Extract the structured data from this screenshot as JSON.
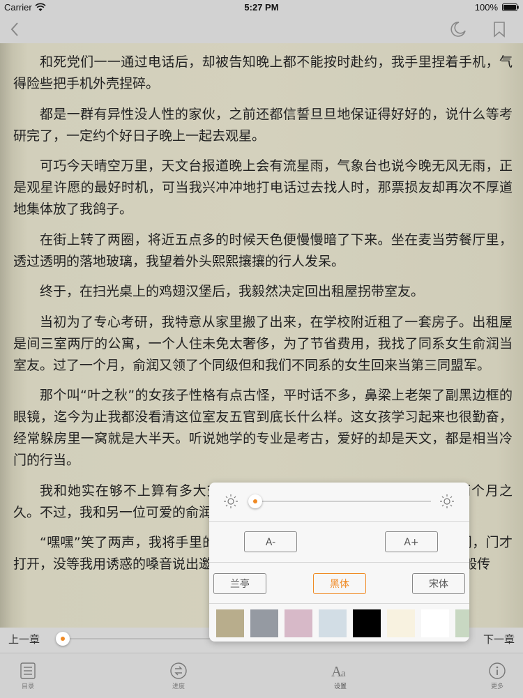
{
  "status_bar": {
    "carrier": "Carrier",
    "time": "5:27 PM",
    "battery": "100%"
  },
  "nav": {
    "back_icon": "chevron-left-icon",
    "night_icon": "moon-icon",
    "bookmark_icon": "bookmark-icon"
  },
  "content": {
    "paragraphs": [
      "和死党们一一通过电话后，却被告知晚上都不能按时赴约，我手里捏着手机，气得险些把手机外壳捏碎。",
      "都是一群有异性没人性的家伙，之前还都信誓旦旦地保证得好好的，说什么等考研完了，一定约个好日子晚上一起去观星。",
      "可巧今天晴空万里，天文台报道晚上会有流星雨，气象台也说今晚无风无雨，正是观星许愿的最好时机，可当我兴冲冲地打电话过去找人时，那票损友却再次不厚道地集体放了我鸽子。",
      "在街上转了两圈，将近五点多的时候天色便慢慢暗了下来。坐在麦当劳餐厅里，透过透明的落地玻璃，我望着外头熙熙攘攘的行人发呆。",
      "终于，在扫光桌上的鸡翅汉堡后，我毅然决定回出租屋拐带室友。",
      "当初为了专心考研，我特意从家里搬了出来，在学校附近租了一套房子。出租屋是间三室两厅的公寓，一个人住未免太奢侈，为了节省费用，我找了同系女生俞润当室友。过了一个月，俞润又领了个同级但和我们不同系的女生回来当第三同盟军。",
      "那个叫“叶之秋”的女孩子性格有点古怪，平时话不多，鼻梁上老架了副黑边框的眼镜，迄今为止我都没看清这位室友五官到底长什么样。这女孩学习起来也很勤奋，经常躲房里一窝就是大半天。听说她学的专业是考古，爱好的却是天文，都是相当冷门的行当。",
      "我和她实在够不上算有多大交情，说起来我们住在一个屋檐底下也才两个月之久。不过，我和另一位可爱的俞润也一样，谈不上有多亲近。",
      "“嘿嘿”笑了两声，我将手里的汉堡纸团扔进垃圾桶，走到出租屋门前敲门，门才打开，没等我用诱惑的嗓音说出邀请，一股阴风扑面而来，我僵住身子，似佛般传"
    ]
  },
  "progress": {
    "prev_label": "上一章",
    "next_label": "下一章",
    "chapter_progress": 0.0
  },
  "settings": {
    "brightness": 0.0,
    "font_decrease_label": "A-",
    "font_increase_label": "A+",
    "fonts": [
      "兰亭",
      "黑体",
      "宋体"
    ],
    "selected_font": "黑体",
    "theme_colors": [
      "#b8ad8c",
      "#959aa2",
      "#d7b9c8",
      "#d2dde5",
      "#000000",
      "#f8f2e0",
      "#ffffff",
      "#c8d8c2"
    ],
    "accent_color": "#f08a24"
  },
  "tabs": [
    {
      "label": "目录",
      "icon": "list-icon"
    },
    {
      "label": "进度",
      "icon": "progress-icon"
    },
    {
      "label": "设置",
      "icon": "font-settings-icon"
    },
    {
      "label": "更多",
      "icon": "info-icon"
    }
  ]
}
